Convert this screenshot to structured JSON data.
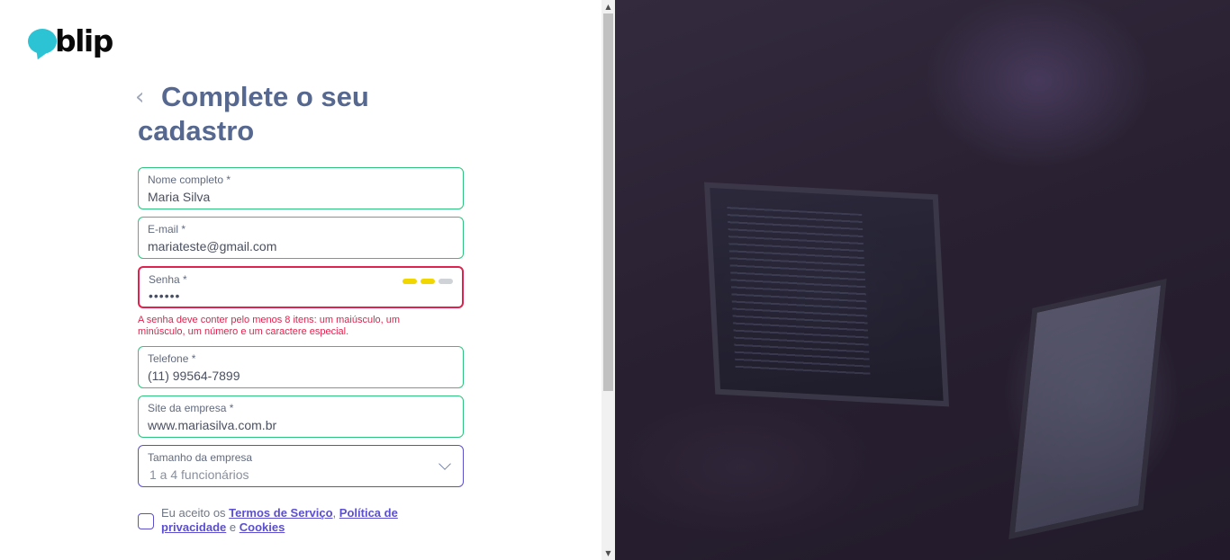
{
  "brand": {
    "logo_text": "blip",
    "accent": "#2cc3d5"
  },
  "header": {
    "title_line1": "Complete o seu",
    "title_line2": "cadastro"
  },
  "form": {
    "name": {
      "label": "Nome completo *",
      "value": "Maria Silva"
    },
    "email": {
      "label": "E-mail *",
      "value": "mariateste@gmail.com"
    },
    "password": {
      "label": "Senha *",
      "value": "••••••",
      "strength_levels": [
        "#f2d600",
        "#f2d600",
        "#cfd2d6"
      ],
      "error": "A senha deve conter pelo menos 8 itens: um maiúsculo, um minúsculo, um número e um caractere especial."
    },
    "phone": {
      "label": "Telefone *",
      "value": "(11) 99564-7899"
    },
    "site": {
      "label": "Site da empresa *",
      "value": "www.mariasilva.com.br"
    },
    "company_size": {
      "label": "Tamanho da empresa",
      "value": "1 a 4 funcionários"
    }
  },
  "terms": {
    "prefix": "Eu aceito os",
    "link1": "Termos de Serviço",
    "sep": ",",
    "link2": "Política de privacidade",
    "and": "e",
    "link3": "Cookies"
  },
  "colors": {
    "valid_border": "#2ec47f",
    "error": "#e0224e",
    "primary": "#5b4fcf",
    "title": "#56688f"
  }
}
